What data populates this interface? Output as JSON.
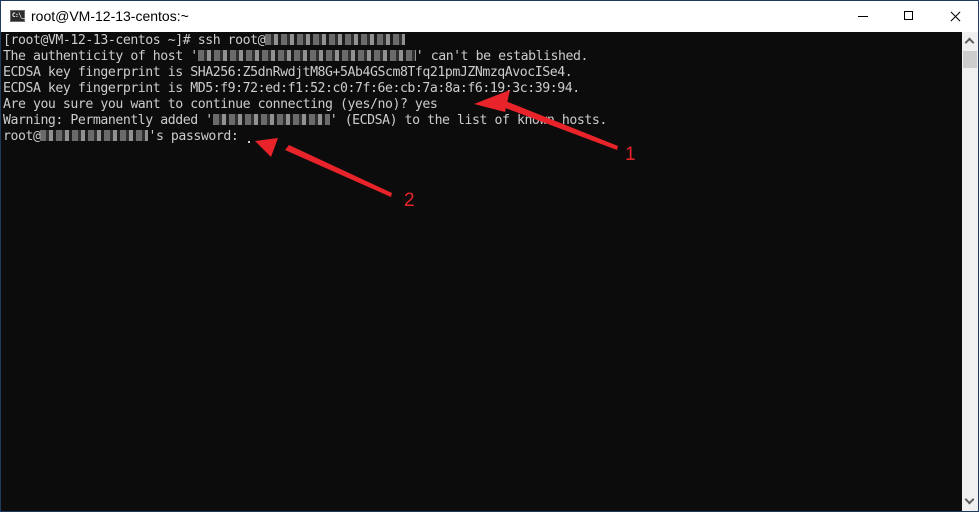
{
  "window": {
    "title": "root@VM-12-13-centos:~",
    "icon": "cmd-icon",
    "controls": [
      "minimize",
      "maximize",
      "close"
    ]
  },
  "terminal": {
    "lines": [
      {
        "pre": "[root@VM-12-13-centos ~]# ssh root@",
        "redacted": true,
        "post": ""
      },
      {
        "pre": "The authenticity of host '",
        "redacted": true,
        "post": "' can't be established."
      },
      {
        "pre": "ECDSA key fingerprint is SHA256:Z5dnRwdjtM8G+5Ab4GScm8Tfq21pmJZNmzqAvocISe4.",
        "redacted": false,
        "post": ""
      },
      {
        "pre": "ECDSA key fingerprint is MD5:f9:72:ed:f1:52:c0:7f:6e:cb:7a:8a:f6:19:3c:39:94.",
        "redacted": false,
        "post": ""
      },
      {
        "pre": "Are you sure you want to continue connecting (yes/no)? yes",
        "redacted": false,
        "post": ""
      },
      {
        "pre": "Warning: Permanently added '",
        "redacted": true,
        "post": "' (ECDSA) to the list of known hosts."
      },
      {
        "pre": "root@",
        "redacted": true,
        "post": "'s password: "
      }
    ]
  },
  "annotations": [
    {
      "label": "1",
      "target": "yes answer",
      "color": "#e8242a"
    },
    {
      "label": "2",
      "target": "password prompt",
      "color": "#e8242a"
    }
  ],
  "scrollbar": {
    "position": "top"
  }
}
